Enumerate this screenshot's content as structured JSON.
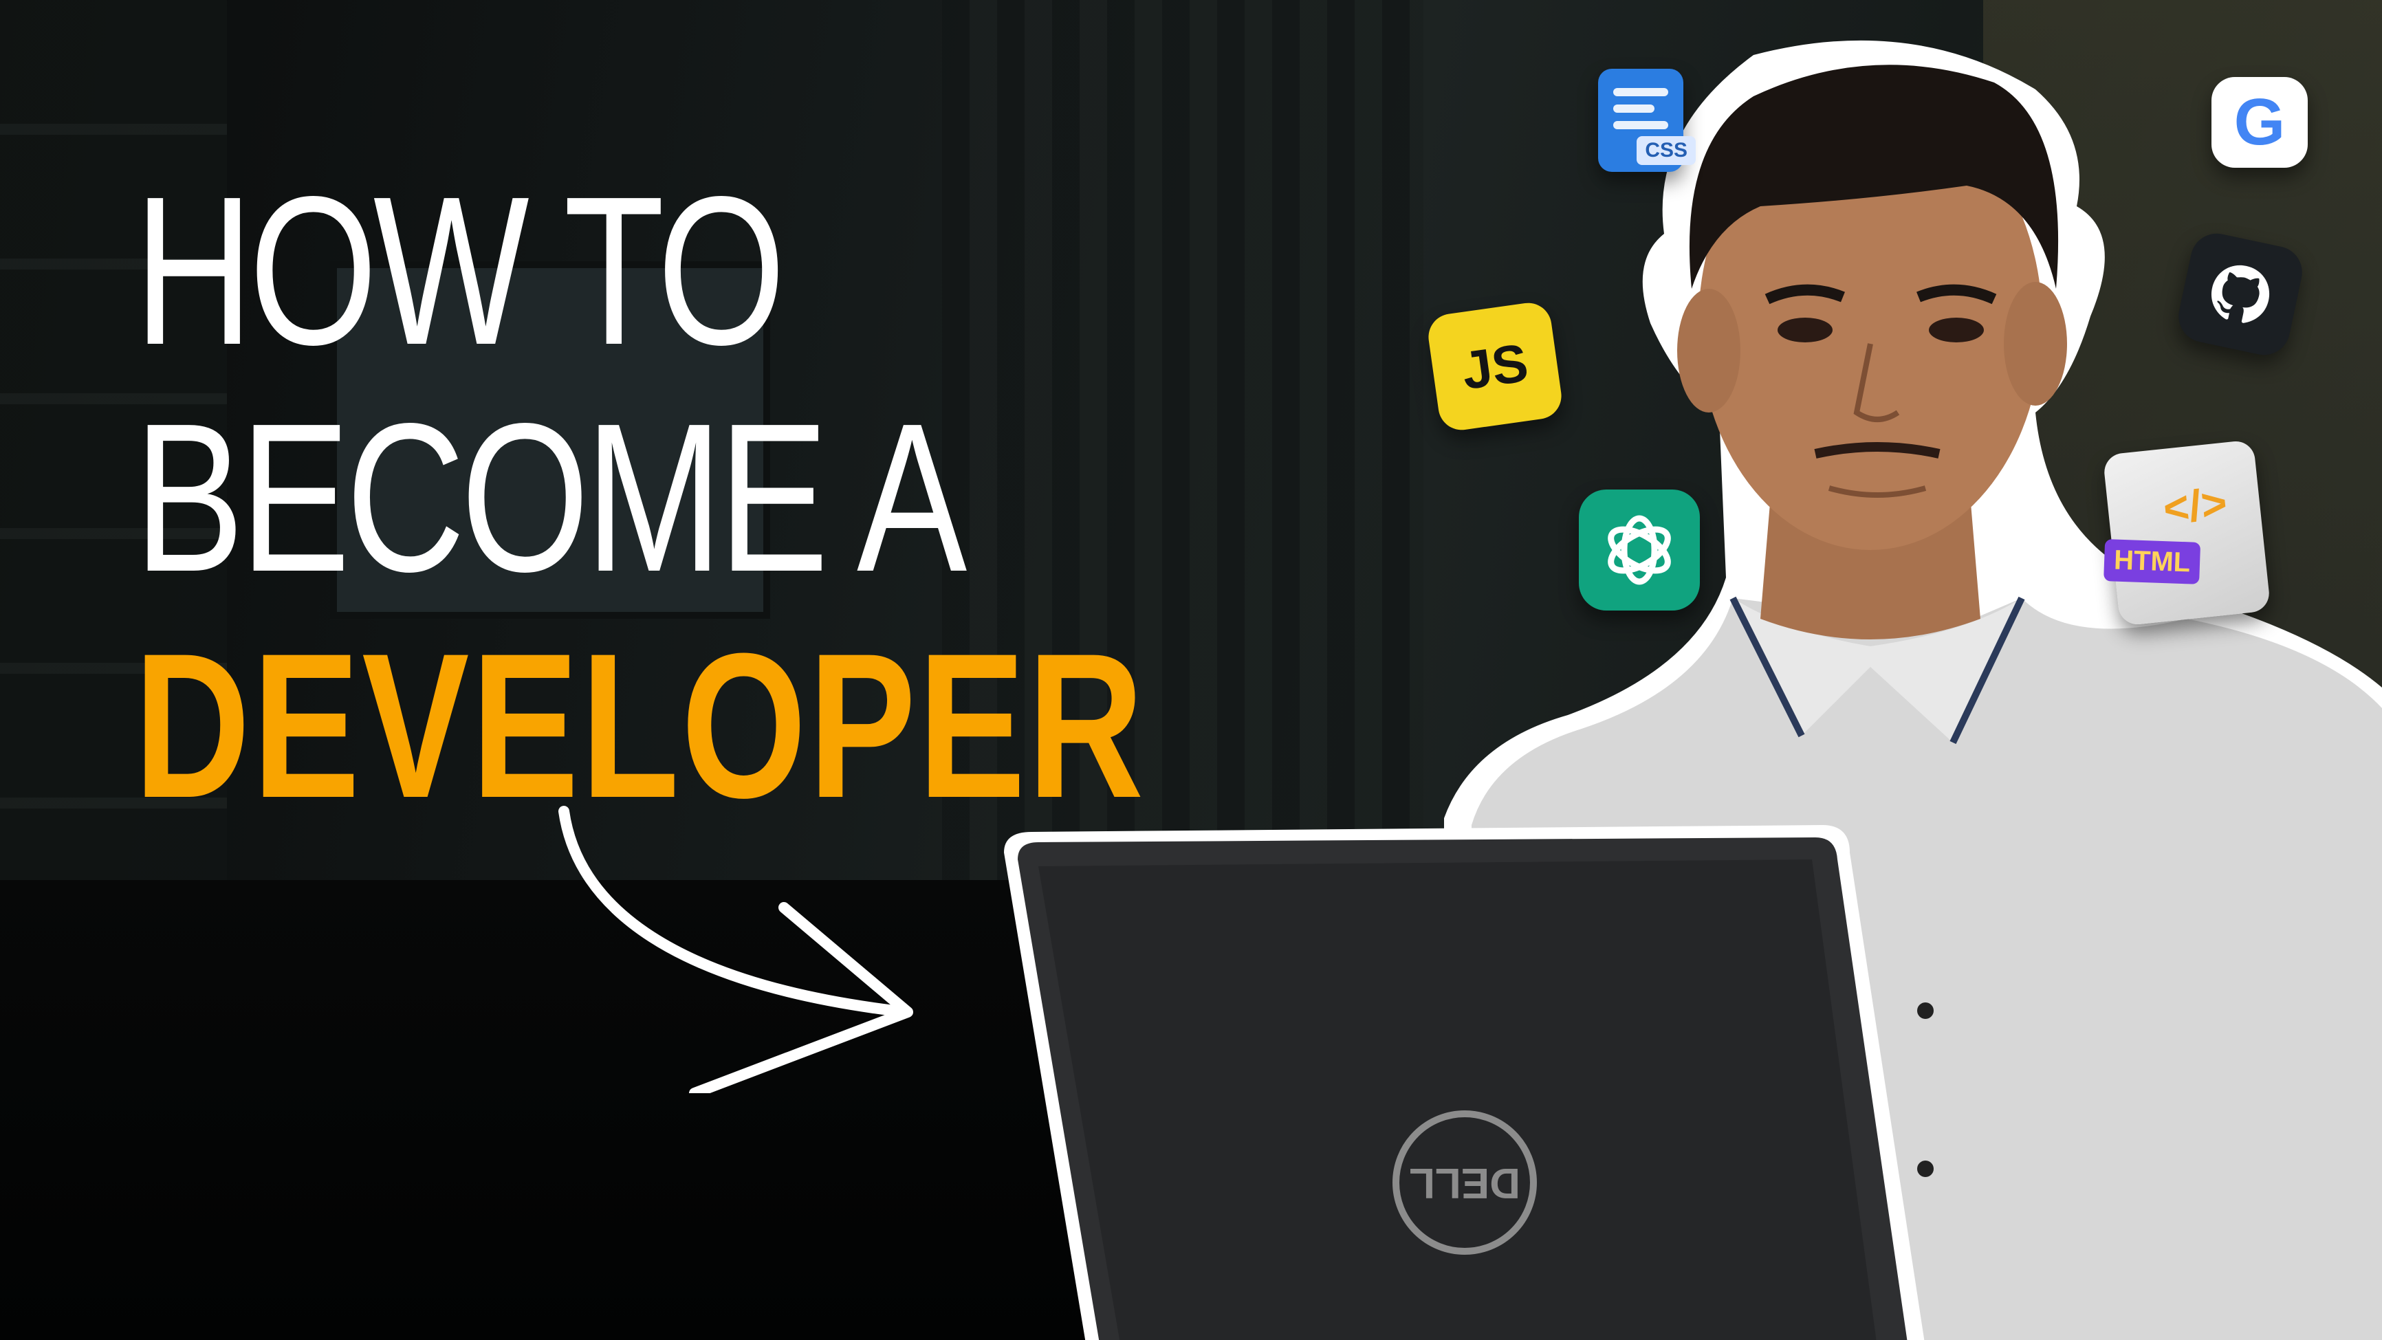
{
  "headline": {
    "line1": "HOW TO",
    "line2": "BECOME A",
    "line3": "DEVELOPER"
  },
  "icons": {
    "css_tag": "CSS",
    "js_label": "JS",
    "html_tag": "HTML",
    "html_code": "</>",
    "google_letter": "G"
  },
  "laptop": {
    "logo_text": "DELL"
  },
  "colors": {
    "accent": "#f9a400",
    "text": "#ffffff",
    "background": "#0b0d0d"
  }
}
